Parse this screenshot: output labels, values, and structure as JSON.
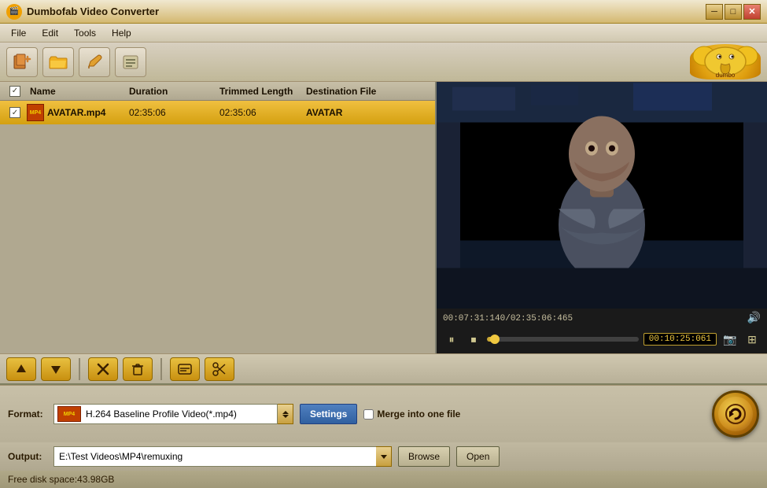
{
  "window": {
    "title": "Dumbofab Video Converter",
    "icon": "🎬"
  },
  "titlebar": {
    "minimize": "─",
    "maximize": "□",
    "close": "✕"
  },
  "menu": {
    "items": [
      "File",
      "Edit",
      "Tools",
      "Help"
    ]
  },
  "toolbar": {
    "add_icon": "＋",
    "folder_icon": "📁",
    "edit_icon": "✏",
    "list_icon": "☰"
  },
  "table": {
    "headers": {
      "name": "Name",
      "duration": "Duration",
      "trimmed": "Trimmed Length",
      "dest": "Destination File"
    },
    "rows": [
      {
        "checked": true,
        "name": "AVATAR.mp4",
        "icon": "MP4",
        "duration": "02:35:06",
        "trimmed": "02:35:06",
        "dest": "AVATAR"
      }
    ]
  },
  "playback": {
    "time_current": "00:07:31:140",
    "time_total": "02:35:06:465",
    "separator": "/",
    "time_code": "00:10:25:061",
    "progress_pct": 5
  },
  "controls": {
    "pause": "⏸",
    "stop": "⏹",
    "volume": "🔊"
  },
  "bottom_toolbar": {
    "up": "↑",
    "down": "↓",
    "remove": "✕",
    "trash": "🗑",
    "comment": "💬",
    "trim": "✂"
  },
  "format_bar": {
    "label": "Format:",
    "value": "H.264 Baseline Profile Video(*.mp4)",
    "settings_label": "Settings",
    "merge_label": "Merge into one file"
  },
  "output_bar": {
    "label": "Output:",
    "value": "E:\\Test Videos\\MP4\\remuxing",
    "browse_label": "Browse",
    "open_label": "Open"
  },
  "status": {
    "text": "Free disk space:43.98GB"
  }
}
